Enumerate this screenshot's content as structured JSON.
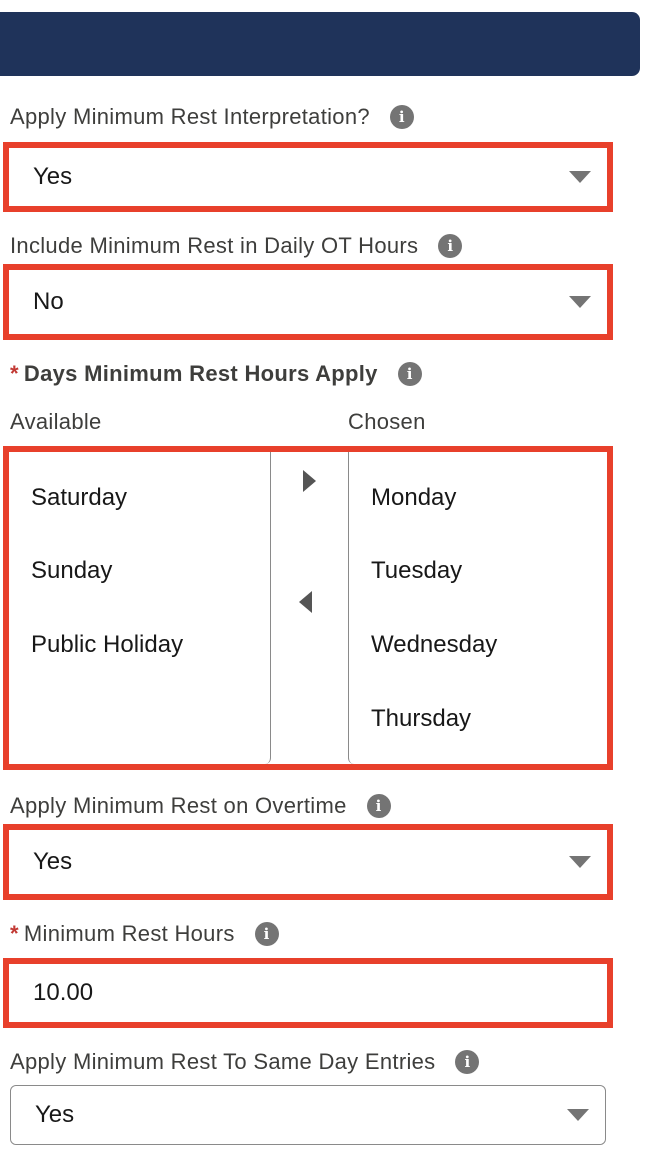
{
  "fields": {
    "apply_min_rest": {
      "label": "Apply Minimum Rest Interpretation?",
      "value": "Yes"
    },
    "include_min_rest_ot": {
      "label": "Include Minimum Rest in Daily OT Hours",
      "value": "No"
    },
    "days_min_rest": {
      "required_marker": "*",
      "label": "Days Minimum Rest Hours Apply",
      "available_label": "Available",
      "chosen_label": "Chosen",
      "available": [
        "Saturday",
        "Sunday",
        "Public Holiday"
      ],
      "chosen": [
        "Monday",
        "Tuesday",
        "Wednesday",
        "Thursday"
      ]
    },
    "apply_min_rest_overtime": {
      "label": "Apply Minimum Rest on Overtime",
      "value": "Yes"
    },
    "min_rest_hours": {
      "required_marker": "*",
      "label": "Minimum Rest Hours",
      "value": "10.00"
    },
    "apply_same_day": {
      "label": "Apply Minimum Rest To Same Day Entries",
      "value": "Yes"
    }
  },
  "info_glyph": "i",
  "icons": [
    "info-icon",
    "chevron-down-icon",
    "move-right-icon",
    "move-left-icon"
  ],
  "colors": {
    "header": "#1f335a",
    "highlight": "#e8402b",
    "required": "#c23934"
  }
}
